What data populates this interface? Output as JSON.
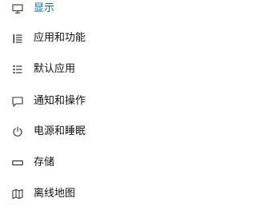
{
  "sidebar": {
    "accent_color": "#0063b1",
    "items": [
      {
        "label": "显示",
        "icon": "monitor-icon",
        "active": true
      },
      {
        "label": "应用和功能",
        "icon": "apps-list-icon",
        "active": false
      },
      {
        "label": "默认应用",
        "icon": "default-apps-icon",
        "active": false
      },
      {
        "label": "通知和操作",
        "icon": "notification-icon",
        "active": false
      },
      {
        "label": "电源和睡眠",
        "icon": "power-icon",
        "active": false
      },
      {
        "label": "存储",
        "icon": "storage-icon",
        "active": false
      },
      {
        "label": "离线地图",
        "icon": "map-icon",
        "active": false
      }
    ]
  }
}
